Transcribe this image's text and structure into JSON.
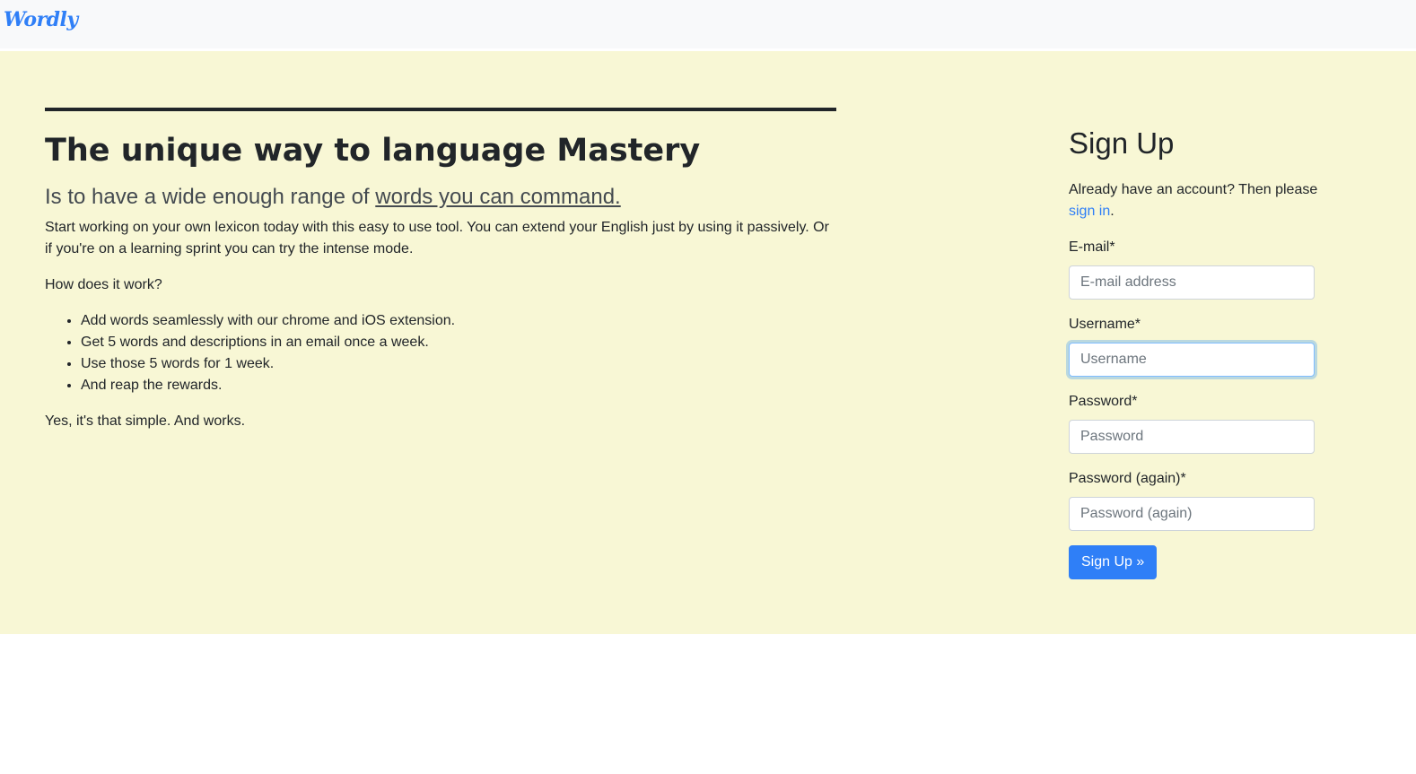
{
  "navbar": {
    "brand": "Wordly"
  },
  "hero": {
    "headline": "The unique way to language Mastery",
    "lead_prefix": "Is to have a wide enough range of ",
    "lead_link": "words you can command.",
    "intro": "Start working on your own lexicon today with this easy to use tool. You can extend your English just by using it passively. Or if you're on a learning sprint you can try the intense mode.",
    "how_title": "How does it work?",
    "steps": [
      "Add words seamlessly with our chrome and iOS extension.",
      "Get 5 words and descriptions in an email once a week.",
      "Use those 5 words for 1 week.",
      "And reap the rewards."
    ],
    "closing": "Yes, it's that simple. And works."
  },
  "signup": {
    "title": "Sign Up",
    "account_text": "Already have an account? Then please ",
    "signin_link": "sign in",
    "account_suffix": ".",
    "email_label": "E-mail*",
    "email_placeholder": "E-mail address",
    "username_label": "Username*",
    "username_placeholder": "Username",
    "password_label": "Password*",
    "password_placeholder": "Password",
    "password2_label": "Password (again)*",
    "password2_placeholder": "Password (again)",
    "submit_label": "Sign Up »"
  },
  "colors": {
    "accent": "#2f7ff7",
    "hero_background": "#f8f7d5",
    "navbar_background": "#f8f9fa"
  }
}
